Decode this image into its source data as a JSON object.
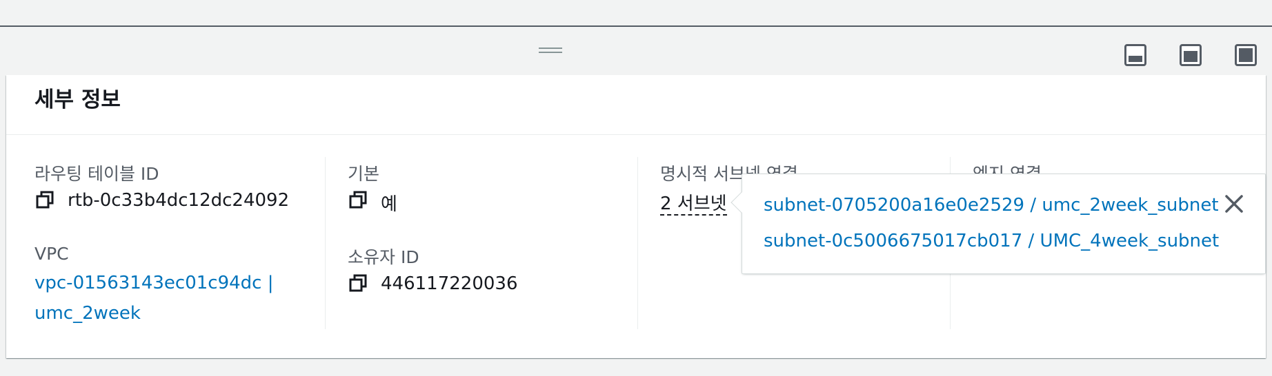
{
  "panel": {
    "title": "세부 정보"
  },
  "fields": {
    "route_table_id": {
      "label": "라우팅 테이블 ID",
      "value": "rtb-0c33b4dc12dc24092"
    },
    "vpc": {
      "label": "VPC",
      "link_line1": "vpc-01563143ec01c94dc |",
      "link_line2": "umc_2week"
    },
    "main": {
      "label": "기본",
      "value": "예"
    },
    "owner_id": {
      "label": "소유자 ID",
      "value": "446117220036"
    },
    "explicit_subnets": {
      "label": "명시적 서브넷 연결",
      "value": "2 서브넷"
    },
    "edge": {
      "label": "엣지 연결"
    }
  },
  "popover": {
    "items": [
      "subnet-0705200a16e0e2529 / umc_2week_subnet",
      "subnet-0c5006675017cb017 / UMC_4week_subnet"
    ],
    "close_icon": "close-icon"
  },
  "toolbar": {
    "icons": [
      "split-bottom-small-icon",
      "split-bottom-medium-icon",
      "split-full-icon",
      "drag-handle-icon"
    ]
  },
  "colors": {
    "link": "#0073bb",
    "text": "#16191f",
    "label": "#545b64",
    "background": "#f2f3f3"
  }
}
